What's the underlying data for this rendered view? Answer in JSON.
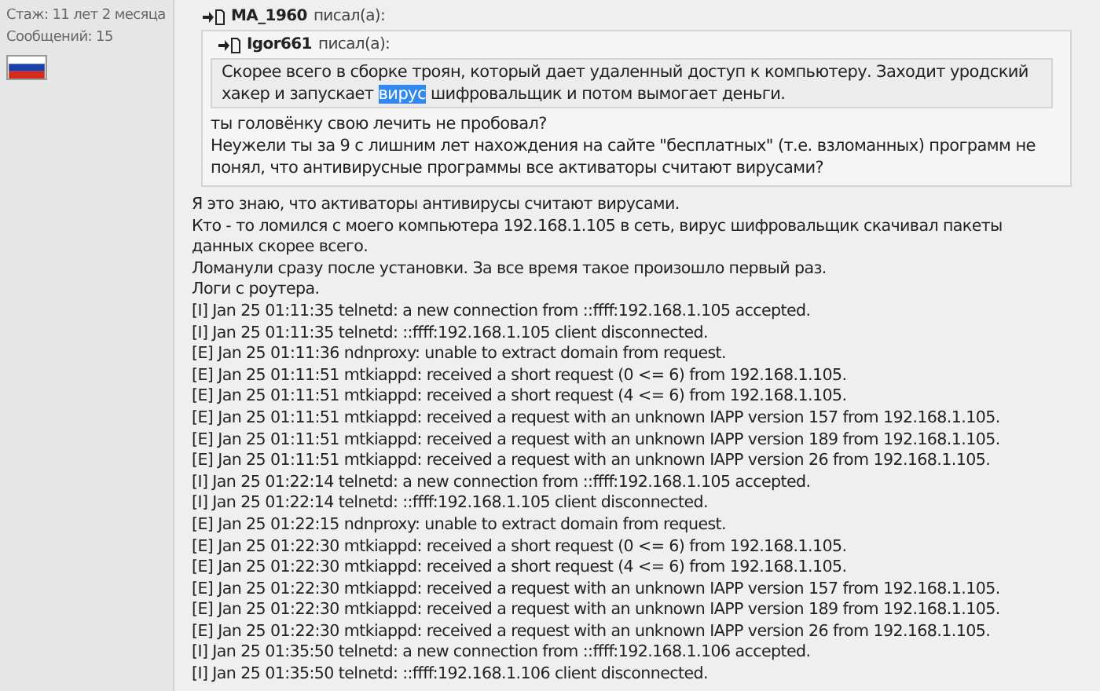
{
  "author_info": {
    "lines": [
      "Стаж: 11 лет 2 месяца",
      "Сообщений: 15"
    ]
  },
  "quote": {
    "author": "MA_1960",
    "verb": "писал(а):",
    "inner_quote": {
      "author": "Igor661",
      "verb": "писал(а):",
      "segments": [
        {
          "text": "Скорее всего в сборке троян, который дает удаленный доступ к компьютеру. Заходит уродский хакер и запускает ",
          "selected": false
        },
        {
          "text": "вирус",
          "selected": true
        },
        {
          "text": " шифровальщик и потом вымогает деньги.",
          "selected": false
        }
      ]
    },
    "lines": [
      "ты головёнку свою лечить не пробовал?",
      "Неужели ты за 9 с лишним лет нахождения на сайте \"бесплатных\" (т.е. взломанных) программ не понял, что антивирусные программы все активаторы считают вирусами?"
    ]
  },
  "post_lines": [
    "Я это знаю, что активаторы антивирусы считают вирусами.",
    "Кто - то ломился с моего компьютера 192.168.1.105 в сеть, вирус шифровальщик скачивал пакеты данных скорее всего.",
    "Ломанули сразу после установки. За все время такое произошло первый раз.",
    "Логи с роутера.",
    "[I] Jan 25 01:11:35 telnetd: a new connection from ::ffff:192.168.1.105 accepted.",
    "[I] Jan 25 01:11:35 telnetd: ::ffff:192.168.1.105 client disconnected.",
    "[E] Jan 25 01:11:36 ndnproxy: unable to extract domain from request.",
    "[E] Jan 25 01:11:51 mtkiappd: received a short request (0 <= 6) from 192.168.1.105.",
    "[E] Jan 25 01:11:51 mtkiappd: received a short request (4 <= 6) from 192.168.1.105.",
    "[E] Jan 25 01:11:51 mtkiappd: received a request with an unknown IAPP version 157 from 192.168.1.105.",
    "[E] Jan 25 01:11:51 mtkiappd: received a request with an unknown IAPP version 189 from 192.168.1.105.",
    "[E] Jan 25 01:11:51 mtkiappd: received a request with an unknown IAPP version 26 from 192.168.1.105.",
    "[I] Jan 25 01:22:14 telnetd: a new connection from ::ffff:192.168.1.105 accepted.",
    "[I] Jan 25 01:22:14 telnetd: ::ffff:192.168.1.105 client disconnected.",
    "[E] Jan 25 01:22:15 ndnproxy: unable to extract domain from request.",
    "[E] Jan 25 01:22:30 mtkiappd: received a short request (0 <= 6) from 192.168.1.105.",
    "[E] Jan 25 01:22:30 mtkiappd: received a short request (4 <= 6) from 192.168.1.105.",
    "[E] Jan 25 01:22:30 mtkiappd: received a request with an unknown IAPP version 157 from 192.168.1.105.",
    "[E] Jan 25 01:22:30 mtkiappd: received a request with an unknown IAPP version 189 from 192.168.1.105.",
    "[E] Jan 25 01:22:30 mtkiappd: received a request with an unknown IAPP version 26 from 192.168.1.105.",
    "[I] Jan 25 01:35:50 telnetd: a new connection from ::ffff:192.168.1.106 accepted.",
    "[I] Jan 25 01:35:50 telnetd: ::ffff:192.168.1.106 client disconnected."
  ]
}
